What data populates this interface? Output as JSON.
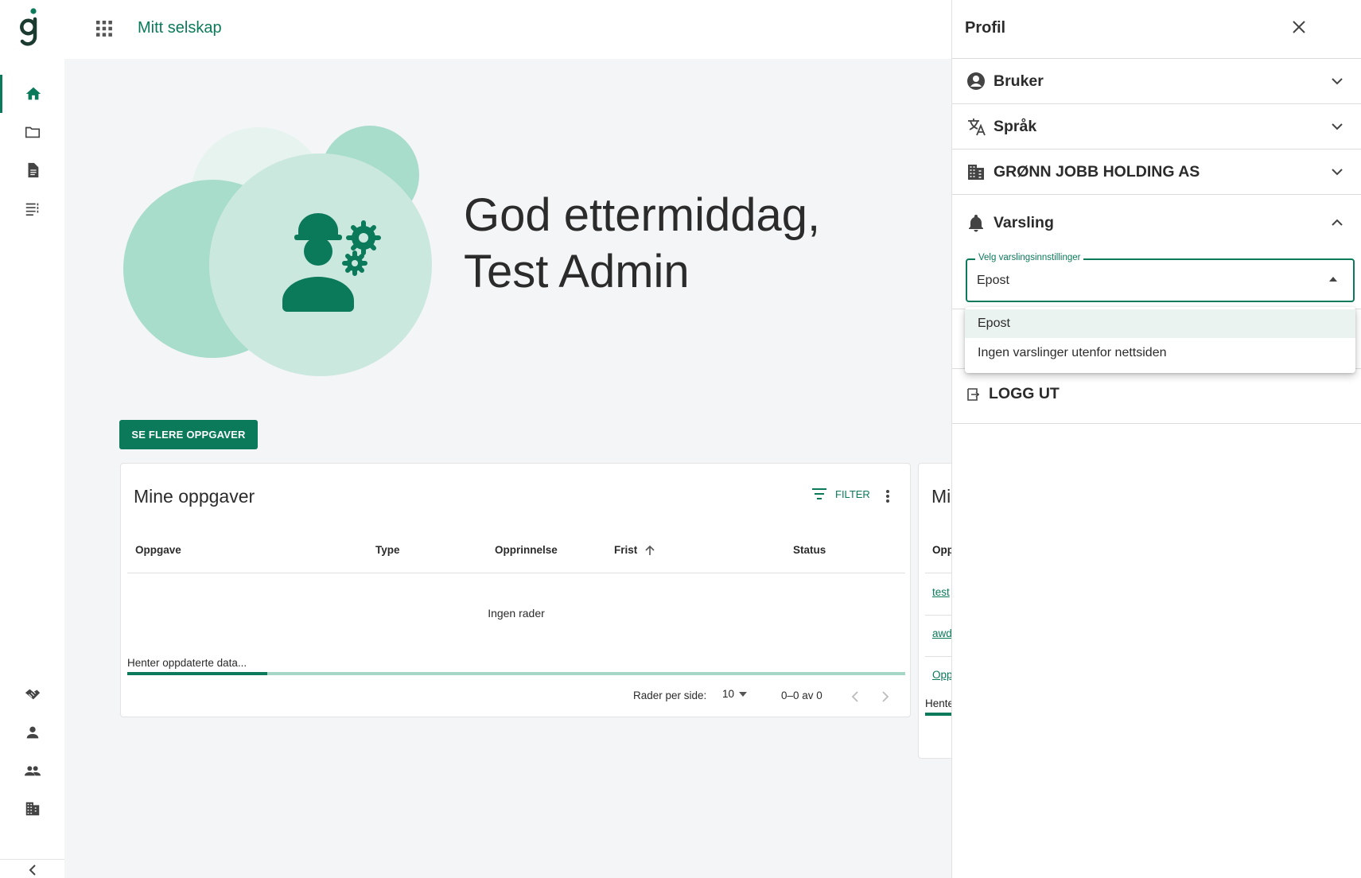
{
  "app": {
    "title": "Mitt selskap"
  },
  "nav": {
    "top_items": [
      "home",
      "folder",
      "document",
      "list"
    ],
    "bottom_items": [
      "handshake",
      "person",
      "people",
      "company"
    ]
  },
  "hero": {
    "greeting_line1": "God ettermiddag,",
    "greeting_line2": "Test Admin"
  },
  "actions": {
    "more_tasks": "SE FLERE OPPGAVER"
  },
  "tasks_card": {
    "title": "Mine oppgaver",
    "filter_label": "FILTER",
    "columns": [
      "Oppgave",
      "Type",
      "Opprinnelse",
      "Frist",
      "Status"
    ],
    "empty_text": "Ingen rader",
    "loading_text": "Henter oppdaterte data...",
    "progress": 0.18,
    "rows_per_page_label": "Rader per side:",
    "rows_per_page": "10",
    "range": "0–0 av 0"
  },
  "second_card": {
    "title": "Mi",
    "column": "Opp",
    "links": [
      "test",
      "awd",
      "Opp"
    ],
    "loading_text": "Hente"
  },
  "profile_panel": {
    "title": "Profil",
    "sections": [
      {
        "label": "Bruker",
        "icon": "account-circle-icon"
      },
      {
        "label": "Språk",
        "icon": "translate-icon"
      },
      {
        "label": "GRØNN JOBB HOLDING AS",
        "icon": "building-icon"
      },
      {
        "label": "Varsling",
        "icon": "bell-icon"
      }
    ],
    "notification_select": {
      "legend": "Velg varslingsinnstillinger",
      "value": "Epost",
      "options": [
        "Epost",
        "Ingen varslinger utenfor nettsiden"
      ]
    },
    "logout_label": "LOGG UT"
  },
  "colors": {
    "accent": "#0b7a5a",
    "light_accent": "#cbe8df",
    "background": "#f4f5f6"
  }
}
